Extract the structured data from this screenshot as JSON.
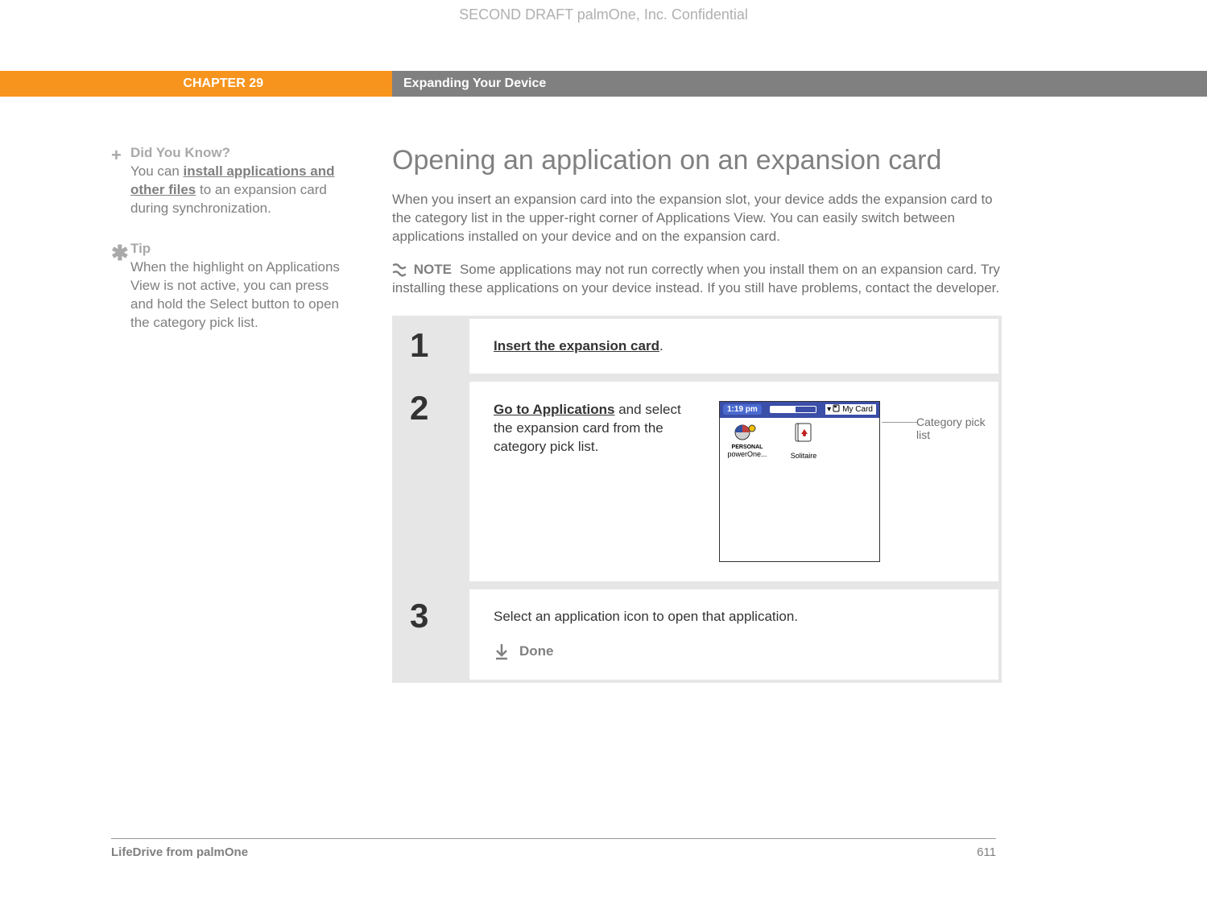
{
  "watermark": "SECOND DRAFT palmOne, Inc.  Confidential",
  "header": {
    "chapter": "CHAPTER 29",
    "title": "Expanding Your Device"
  },
  "sidebar": {
    "didYouKnow": {
      "heading": "Did You Know?",
      "pre": "You can ",
      "link": "install applications and other files",
      "post": " to an expansion card during synchronization."
    },
    "tip": {
      "heading": "Tip",
      "text": "When the highlight on Applications View is not active, you can press and hold the Select button to open the category pick list."
    }
  },
  "main": {
    "heading": "Opening an application on an expansion card",
    "intro": "When you insert an expansion card into the expansion slot, your device adds the expansion card to the category list in the upper-right corner of Applications View. You can easily switch between applications installed on your device and on the expansion card.",
    "note": {
      "label": "NOTE",
      "text": "Some applications may not run correctly when you install them on an expansion card. Try installing these applications on your device instead. If you still have problems, contact the developer."
    },
    "steps": {
      "s1": {
        "num": "1",
        "link": "Insert the expansion card",
        "tail": "."
      },
      "s2": {
        "num": "2",
        "link": "Go to Applications",
        "tail": " and select the expansion card from the category pick list.",
        "screenshot": {
          "time": "1:19 pm",
          "category": "My Card",
          "apps": [
            {
              "label1": "PERSONAL",
              "label2": "powerOne..."
            },
            {
              "label1": "",
              "label2": "Solitaire"
            }
          ]
        },
        "callout": "Category pick list"
      },
      "s3": {
        "num": "3",
        "text": "Select an application icon to open that application.",
        "done": "Done"
      }
    }
  },
  "footer": {
    "product": "LifeDrive from palmOne",
    "page": "611"
  }
}
